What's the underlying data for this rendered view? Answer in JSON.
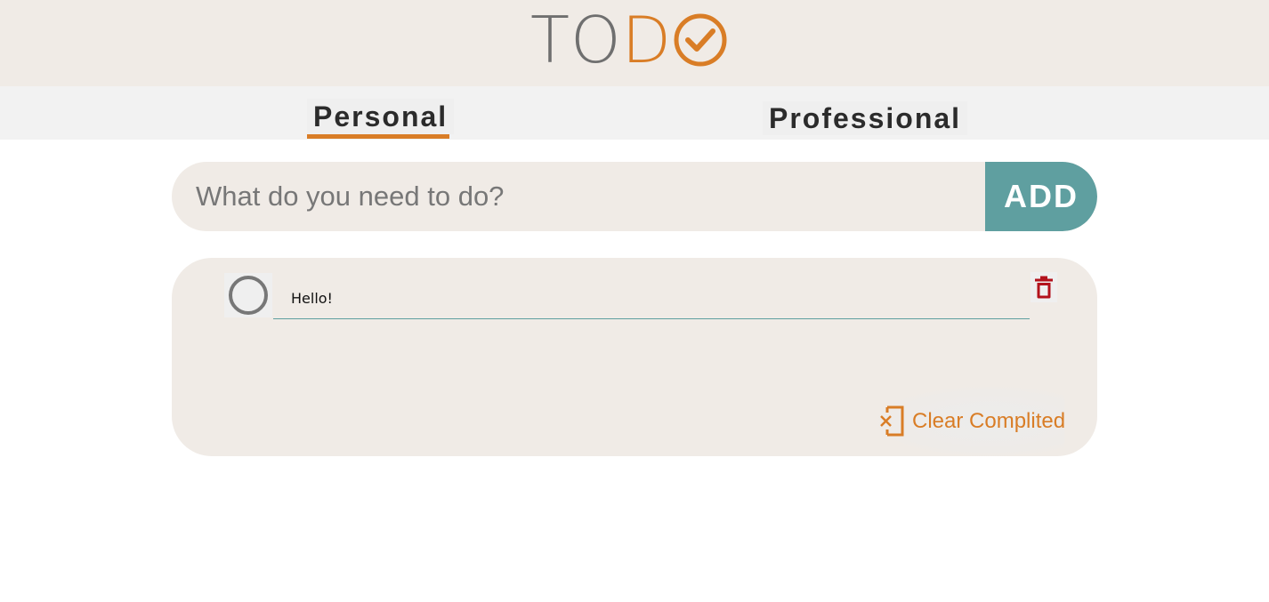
{
  "header": {
    "logo_text_part1": "TO",
    "logo_text_part2": "D",
    "logo_icon": "check-circle-icon"
  },
  "tabs": [
    {
      "label": "Personal",
      "active": true
    },
    {
      "label": "Professional",
      "active": false
    }
  ],
  "add_form": {
    "placeholder": "What do you need to do?",
    "value": "",
    "add_label": "ADD"
  },
  "todos": [
    {
      "text": "Hello!",
      "completed": false
    }
  ],
  "actions": {
    "clear_label": "Clear Complited",
    "clear_icon": "clear-completed-icon",
    "delete_icon": "trash-icon"
  },
  "colors": {
    "accent": "#d97d26",
    "teal": "#5f9fa0",
    "delete": "#b3121c",
    "header_bg": "#f0ebe6"
  }
}
